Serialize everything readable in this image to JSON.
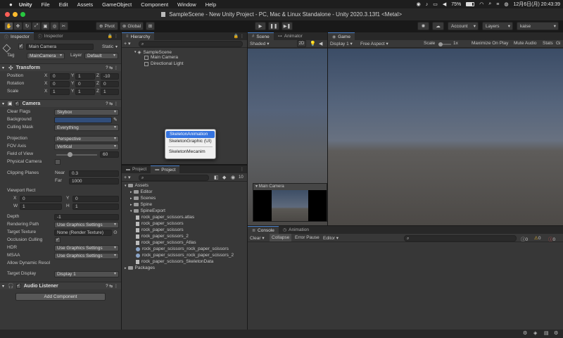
{
  "menubar": {
    "app": "Unity",
    "items": [
      "File",
      "Edit",
      "Assets",
      "GameObject",
      "Component",
      "Window",
      "Help"
    ],
    "battery": "75%",
    "datetime": "12月6日(月)  20:43:39"
  },
  "window": {
    "title": "SampleScene - New Unity Project - PC, Mac & Linux Standalone - Unity 2020.3.13f1 <Metal>"
  },
  "toolbar": {
    "pivot": "Pivot",
    "global": "Global",
    "account": "Account",
    "layers": "Layers",
    "layout": "kaise"
  },
  "inspector": {
    "tab1": "Inspector",
    "tab2": "Inspector",
    "object_name": "Main Camera",
    "static": "Static",
    "tag_label": "Tag",
    "tag_value": "MainCamera",
    "layer_label": "Layer",
    "layer_value": "Default",
    "transform": {
      "title": "Transform",
      "rows": [
        {
          "label": "Position",
          "x": "0",
          "y": "1",
          "z": "-10"
        },
        {
          "label": "Rotation",
          "x": "0",
          "y": "0",
          "z": "0"
        },
        {
          "label": "Scale",
          "x": "1",
          "y": "1",
          "z": "1"
        }
      ]
    },
    "camera": {
      "title": "Camera",
      "clear_flags": {
        "label": "Clear Flags",
        "value": "Skybox"
      },
      "background": {
        "label": "Background"
      },
      "culling_mask": {
        "label": "Culling Mask",
        "value": "Everything"
      },
      "projection": {
        "label": "Projection",
        "value": "Perspective"
      },
      "fov_axis": {
        "label": "FOV Axis",
        "value": "Vertical"
      },
      "field_of_view": {
        "label": "Field of View",
        "value": "60"
      },
      "physical_camera": {
        "label": "Physical Camera"
      },
      "clipping_planes": {
        "label": "Clipping Planes",
        "near_label": "Near",
        "near": "0.3",
        "far_label": "Far",
        "far": "1000"
      },
      "viewport_rect": {
        "label": "Viewport Rect",
        "x": "0",
        "y": "0",
        "w": "1",
        "h": "1"
      },
      "depth": {
        "label": "Depth",
        "value": "-1"
      },
      "rendering_path": {
        "label": "Rendering Path",
        "value": "Use Graphics Settings"
      },
      "target_texture": {
        "label": "Target Texture",
        "value": "None (Render Texture)"
      },
      "occlusion_culling": {
        "label": "Occlusion Culling"
      },
      "hdr": {
        "label": "HDR",
        "value": "Use Graphics Settings"
      },
      "msaa": {
        "label": "MSAA",
        "value": "Use Graphics Settings"
      },
      "allow_dynamic": {
        "label": "Allow Dynamic Resol"
      },
      "target_display": {
        "label": "Target Display",
        "value": "Display 1"
      }
    },
    "audio_listener": {
      "title": "Audio Listener"
    },
    "add_component": "Add Component"
  },
  "hierarchy": {
    "tab": "Hierarchy",
    "scene": "SampleScene",
    "items": [
      "Main Camera",
      "Directional Light"
    ]
  },
  "popup": {
    "items": [
      "SkeletonAnimation",
      "SkeletonGraphic (UI)",
      "SkeletonMecanim"
    ]
  },
  "project": {
    "tab1": "Project",
    "tab2": "Project",
    "count": "10",
    "tree": [
      {
        "label": "Assets",
        "level": 0,
        "icon": "folder"
      },
      {
        "label": "Editor",
        "level": 1,
        "icon": "folder"
      },
      {
        "label": "Scenes",
        "level": 1,
        "icon": "folder"
      },
      {
        "label": "Spine",
        "level": 1,
        "icon": "folder"
      },
      {
        "label": "SpineExport",
        "level": 1,
        "icon": "folder"
      },
      {
        "label": "rock_paper_scissors.atlas",
        "level": 2,
        "icon": "file"
      },
      {
        "label": "rock_paper_scissors",
        "level": 2,
        "icon": "file"
      },
      {
        "label": "rock_paper_scissors",
        "level": 2,
        "icon": "file"
      },
      {
        "label": "rock_paper_scissors_2",
        "level": 2,
        "icon": "file"
      },
      {
        "label": "rock_paper_scissors_Atlas",
        "level": 2,
        "icon": "file"
      },
      {
        "label": "rock_paper_scissors_rock_paper_scissors",
        "level": 2,
        "icon": "skeleton"
      },
      {
        "label": "rock_paper_scissors_rock_paper_scissors_2",
        "level": 2,
        "icon": "skeleton"
      },
      {
        "label": "rock_paper_scissors_SkeletonData",
        "level": 2,
        "icon": "file"
      },
      {
        "label": "Packages",
        "level": 0,
        "icon": "folder"
      }
    ]
  },
  "scene": {
    "tab": "Scene",
    "tab2": "Animator",
    "shading": "Shaded",
    "mode2d": "2D",
    "preview_title": "Main Camera"
  },
  "game": {
    "tab": "Game",
    "display": "Display 1",
    "aspect": "Free Aspect",
    "scale_label": "Scale",
    "scale_value": "1x",
    "maximize": "Maximize On Play",
    "mute": "Mute Audio",
    "stats": "Stats",
    "gizmos": "Gi"
  },
  "console": {
    "tab": "Console",
    "tab2": "Animation",
    "clear": "Clear",
    "collapse": "Collapse",
    "error_pause": "Error Pause",
    "editor": "Editor",
    "search_placeholder": "",
    "info": "0",
    "warn": "0",
    "err": "0"
  }
}
